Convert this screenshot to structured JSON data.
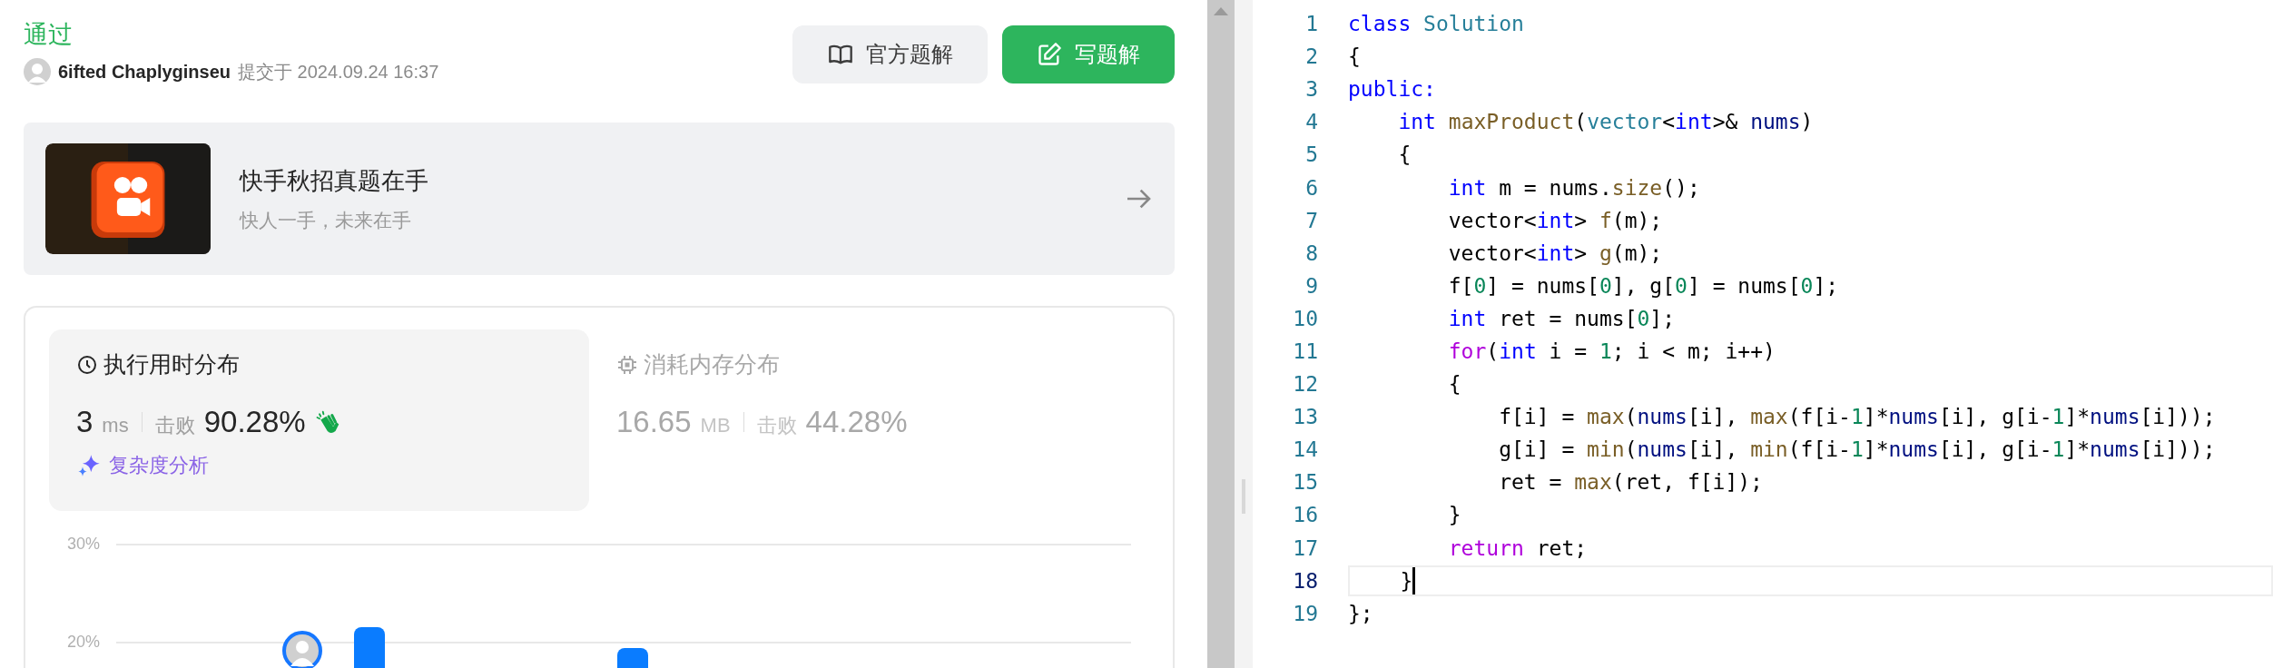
{
  "status": "通过",
  "submission": {
    "author": "6ifted Chaplyginseu",
    "submitted": "提交于 2024.09.24 16:37"
  },
  "buttons": [
    {
      "label": "官方题解",
      "kind": "secondary"
    },
    {
      "label": "写题解",
      "kind": "primary"
    }
  ],
  "banner": {
    "title": "快手秋招真题在手",
    "subtitle": "快人一手，未来在手"
  },
  "stats": [
    {
      "kind": "time",
      "title": "执行用时分布",
      "value": "3",
      "unit": "ms",
      "beat_label": "击败",
      "beat": "90.28%",
      "selected": true
    },
    {
      "kind": "memory",
      "title": "消耗内存分布",
      "value": "16.65",
      "unit": "MB",
      "beat_label": "击败",
      "beat": "44.28%",
      "selected": false
    }
  ],
  "analysis_link": "复杂度分析",
  "chart": {
    "ticks": [
      "30%",
      "20%"
    ]
  },
  "code": {
    "lines": [
      {
        "number": "1",
        "current": false,
        "tokens": [
          {
            "t": "class ",
            "kind": "keyword"
          },
          {
            "t": "Solution",
            "kind": "type"
          }
        ]
      },
      {
        "number": "2",
        "current": false,
        "tokens": [
          {
            "t": "{",
            "kind": "plain"
          }
        ]
      },
      {
        "number": "3",
        "current": false,
        "tokens": [
          {
            "t": "public:",
            "kind": "keyword"
          }
        ]
      },
      {
        "number": "4",
        "current": false,
        "tokens": [
          {
            "t": "    int ",
            "kind": "keyword"
          },
          {
            "t": "maxProduct",
            "kind": "function"
          },
          {
            "t": "(",
            "kind": "plain"
          },
          {
            "t": "vector",
            "kind": "type"
          },
          {
            "t": "<",
            "kind": "plain"
          },
          {
            "t": "int",
            "kind": "keyword"
          },
          {
            "t": ">& ",
            "kind": "plain"
          },
          {
            "t": "nums",
            "kind": "variable"
          },
          {
            "t": ")",
            "kind": "plain"
          }
        ]
      },
      {
        "number": "5",
        "current": false,
        "tokens": [
          {
            "t": "    {",
            "kind": "plain"
          }
        ]
      },
      {
        "number": "6",
        "current": false,
        "tokens": [
          {
            "t": "        int",
            "kind": "keyword"
          },
          {
            "t": " m = nums.",
            "kind": "plain"
          },
          {
            "t": "size",
            "kind": "function"
          },
          {
            "t": "();",
            "kind": "plain"
          }
        ]
      },
      {
        "number": "7",
        "current": false,
        "tokens": [
          {
            "t": "        vector<",
            "kind": "plain"
          },
          {
            "t": "int",
            "kind": "keyword"
          },
          {
            "t": "> ",
            "kind": "plain"
          },
          {
            "t": "f",
            "kind": "function"
          },
          {
            "t": "(m);",
            "kind": "plain"
          }
        ]
      },
      {
        "number": "8",
        "current": false,
        "tokens": [
          {
            "t": "        vector<",
            "kind": "plain"
          },
          {
            "t": "int",
            "kind": "keyword"
          },
          {
            "t": "> ",
            "kind": "plain"
          },
          {
            "t": "g",
            "kind": "function"
          },
          {
            "t": "(m);",
            "kind": "plain"
          }
        ]
      },
      {
        "number": "9",
        "current": false,
        "tokens": [
          {
            "t": "        f[",
            "kind": "plain"
          },
          {
            "t": "0",
            "kind": "number"
          },
          {
            "t": "] = nums[",
            "kind": "plain"
          },
          {
            "t": "0",
            "kind": "number"
          },
          {
            "t": "], g[",
            "kind": "plain"
          },
          {
            "t": "0",
            "kind": "number"
          },
          {
            "t": "] = nums[",
            "kind": "plain"
          },
          {
            "t": "0",
            "kind": "number"
          },
          {
            "t": "];",
            "kind": "plain"
          }
        ]
      },
      {
        "number": "10",
        "current": false,
        "tokens": [
          {
            "t": "        int",
            "kind": "keyword"
          },
          {
            "t": " ret = nums[",
            "kind": "plain"
          },
          {
            "t": "0",
            "kind": "number"
          },
          {
            "t": "];",
            "kind": "plain"
          }
        ]
      },
      {
        "number": "11",
        "current": false,
        "tokens": [
          {
            "t": "        for",
            "kind": "control"
          },
          {
            "t": "(",
            "kind": "plain"
          },
          {
            "t": "int",
            "kind": "keyword"
          },
          {
            "t": " i = ",
            "kind": "plain"
          },
          {
            "t": "1",
            "kind": "number"
          },
          {
            "t": "; i < m; i++)",
            "kind": "plain"
          }
        ]
      },
      {
        "number": "12",
        "current": false,
        "tokens": [
          {
            "t": "        {",
            "kind": "plain"
          }
        ]
      },
      {
        "number": "13",
        "current": false,
        "tokens": [
          {
            "t": "            f[i] = ",
            "kind": "plain"
          },
          {
            "t": "max",
            "kind": "function"
          },
          {
            "t": "(",
            "kind": "plain"
          },
          {
            "t": "nums",
            "kind": "variable"
          },
          {
            "t": "[i], ",
            "kind": "plain"
          },
          {
            "t": "max",
            "kind": "function"
          },
          {
            "t": "(f[i-",
            "kind": "plain"
          },
          {
            "t": "1",
            "kind": "number"
          },
          {
            "t": "]*",
            "kind": "plain"
          },
          {
            "t": "nums",
            "kind": "variable"
          },
          {
            "t": "[i], g[i-",
            "kind": "plain"
          },
          {
            "t": "1",
            "kind": "number"
          },
          {
            "t": "]*",
            "kind": "plain"
          },
          {
            "t": "nums",
            "kind": "variable"
          },
          {
            "t": "[i]));",
            "kind": "plain"
          }
        ]
      },
      {
        "number": "14",
        "current": false,
        "tokens": [
          {
            "t": "            g[i] = ",
            "kind": "plain"
          },
          {
            "t": "min",
            "kind": "function"
          },
          {
            "t": "(",
            "kind": "plain"
          },
          {
            "t": "nums",
            "kind": "variable"
          },
          {
            "t": "[i], ",
            "kind": "plain"
          },
          {
            "t": "min",
            "kind": "function"
          },
          {
            "t": "(f[i-",
            "kind": "plain"
          },
          {
            "t": "1",
            "kind": "number"
          },
          {
            "t": "]*",
            "kind": "plain"
          },
          {
            "t": "nums",
            "kind": "variable"
          },
          {
            "t": "[i], g[i-",
            "kind": "plain"
          },
          {
            "t": "1",
            "kind": "number"
          },
          {
            "t": "]*",
            "kind": "plain"
          },
          {
            "t": "nums",
            "kind": "variable"
          },
          {
            "t": "[i]));",
            "kind": "plain"
          }
        ]
      },
      {
        "number": "15",
        "current": false,
        "tokens": [
          {
            "t": "            ret = ",
            "kind": "plain"
          },
          {
            "t": "max",
            "kind": "function"
          },
          {
            "t": "(ret, f[i]);",
            "kind": "plain"
          }
        ]
      },
      {
        "number": "16",
        "current": false,
        "tokens": [
          {
            "t": "        }",
            "kind": "plain"
          }
        ]
      },
      {
        "number": "17",
        "current": false,
        "tokens": [
          {
            "t": "        return",
            "kind": "control"
          },
          {
            "t": " ret;",
            "kind": "plain"
          }
        ]
      },
      {
        "number": "18",
        "current": true,
        "tokens": [
          {
            "t": "    }",
            "kind": "plain"
          }
        ]
      },
      {
        "number": "19",
        "current": false,
        "tokens": [
          {
            "t": "};",
            "kind": "plain"
          }
        ]
      }
    ]
  }
}
